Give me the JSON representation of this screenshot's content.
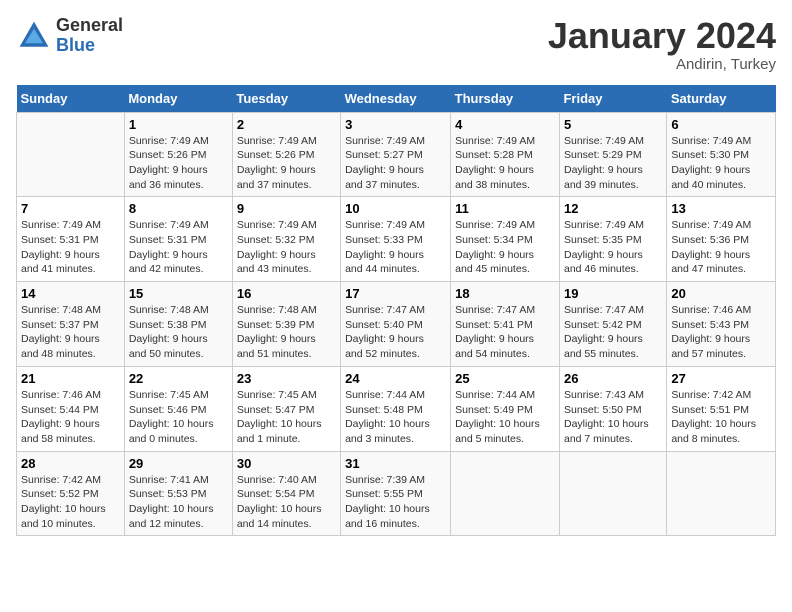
{
  "header": {
    "logo_general": "General",
    "logo_blue": "Blue",
    "month_title": "January 2024",
    "location": "Andirin, Turkey"
  },
  "weekdays": [
    "Sunday",
    "Monday",
    "Tuesday",
    "Wednesday",
    "Thursday",
    "Friday",
    "Saturday"
  ],
  "weeks": [
    [
      {
        "day": "",
        "info": ""
      },
      {
        "day": "1",
        "info": "Sunrise: 7:49 AM\nSunset: 5:26 PM\nDaylight: 9 hours\nand 36 minutes."
      },
      {
        "day": "2",
        "info": "Sunrise: 7:49 AM\nSunset: 5:26 PM\nDaylight: 9 hours\nand 37 minutes."
      },
      {
        "day": "3",
        "info": "Sunrise: 7:49 AM\nSunset: 5:27 PM\nDaylight: 9 hours\nand 37 minutes."
      },
      {
        "day": "4",
        "info": "Sunrise: 7:49 AM\nSunset: 5:28 PM\nDaylight: 9 hours\nand 38 minutes."
      },
      {
        "day": "5",
        "info": "Sunrise: 7:49 AM\nSunset: 5:29 PM\nDaylight: 9 hours\nand 39 minutes."
      },
      {
        "day": "6",
        "info": "Sunrise: 7:49 AM\nSunset: 5:30 PM\nDaylight: 9 hours\nand 40 minutes."
      }
    ],
    [
      {
        "day": "7",
        "info": "Sunrise: 7:49 AM\nSunset: 5:31 PM\nDaylight: 9 hours\nand 41 minutes."
      },
      {
        "day": "8",
        "info": "Sunrise: 7:49 AM\nSunset: 5:31 PM\nDaylight: 9 hours\nand 42 minutes."
      },
      {
        "day": "9",
        "info": "Sunrise: 7:49 AM\nSunset: 5:32 PM\nDaylight: 9 hours\nand 43 minutes."
      },
      {
        "day": "10",
        "info": "Sunrise: 7:49 AM\nSunset: 5:33 PM\nDaylight: 9 hours\nand 44 minutes."
      },
      {
        "day": "11",
        "info": "Sunrise: 7:49 AM\nSunset: 5:34 PM\nDaylight: 9 hours\nand 45 minutes."
      },
      {
        "day": "12",
        "info": "Sunrise: 7:49 AM\nSunset: 5:35 PM\nDaylight: 9 hours\nand 46 minutes."
      },
      {
        "day": "13",
        "info": "Sunrise: 7:49 AM\nSunset: 5:36 PM\nDaylight: 9 hours\nand 47 minutes."
      }
    ],
    [
      {
        "day": "14",
        "info": "Sunrise: 7:48 AM\nSunset: 5:37 PM\nDaylight: 9 hours\nand 48 minutes."
      },
      {
        "day": "15",
        "info": "Sunrise: 7:48 AM\nSunset: 5:38 PM\nDaylight: 9 hours\nand 50 minutes."
      },
      {
        "day": "16",
        "info": "Sunrise: 7:48 AM\nSunset: 5:39 PM\nDaylight: 9 hours\nand 51 minutes."
      },
      {
        "day": "17",
        "info": "Sunrise: 7:47 AM\nSunset: 5:40 PM\nDaylight: 9 hours\nand 52 minutes."
      },
      {
        "day": "18",
        "info": "Sunrise: 7:47 AM\nSunset: 5:41 PM\nDaylight: 9 hours\nand 54 minutes."
      },
      {
        "day": "19",
        "info": "Sunrise: 7:47 AM\nSunset: 5:42 PM\nDaylight: 9 hours\nand 55 minutes."
      },
      {
        "day": "20",
        "info": "Sunrise: 7:46 AM\nSunset: 5:43 PM\nDaylight: 9 hours\nand 57 minutes."
      }
    ],
    [
      {
        "day": "21",
        "info": "Sunrise: 7:46 AM\nSunset: 5:44 PM\nDaylight: 9 hours\nand 58 minutes."
      },
      {
        "day": "22",
        "info": "Sunrise: 7:45 AM\nSunset: 5:46 PM\nDaylight: 10 hours\nand 0 minutes."
      },
      {
        "day": "23",
        "info": "Sunrise: 7:45 AM\nSunset: 5:47 PM\nDaylight: 10 hours\nand 1 minute."
      },
      {
        "day": "24",
        "info": "Sunrise: 7:44 AM\nSunset: 5:48 PM\nDaylight: 10 hours\nand 3 minutes."
      },
      {
        "day": "25",
        "info": "Sunrise: 7:44 AM\nSunset: 5:49 PM\nDaylight: 10 hours\nand 5 minutes."
      },
      {
        "day": "26",
        "info": "Sunrise: 7:43 AM\nSunset: 5:50 PM\nDaylight: 10 hours\nand 7 minutes."
      },
      {
        "day": "27",
        "info": "Sunrise: 7:42 AM\nSunset: 5:51 PM\nDaylight: 10 hours\nand 8 minutes."
      }
    ],
    [
      {
        "day": "28",
        "info": "Sunrise: 7:42 AM\nSunset: 5:52 PM\nDaylight: 10 hours\nand 10 minutes."
      },
      {
        "day": "29",
        "info": "Sunrise: 7:41 AM\nSunset: 5:53 PM\nDaylight: 10 hours\nand 12 minutes."
      },
      {
        "day": "30",
        "info": "Sunrise: 7:40 AM\nSunset: 5:54 PM\nDaylight: 10 hours\nand 14 minutes."
      },
      {
        "day": "31",
        "info": "Sunrise: 7:39 AM\nSunset: 5:55 PM\nDaylight: 10 hours\nand 16 minutes."
      },
      {
        "day": "",
        "info": ""
      },
      {
        "day": "",
        "info": ""
      },
      {
        "day": "",
        "info": ""
      }
    ]
  ]
}
